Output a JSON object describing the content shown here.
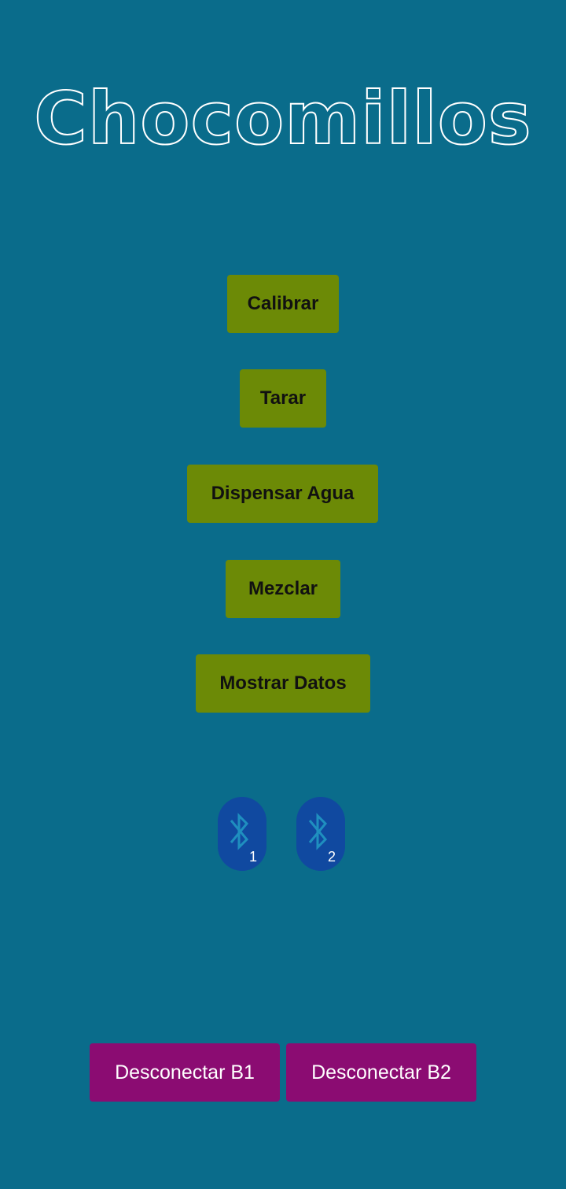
{
  "app": {
    "title": "Chocomillos"
  },
  "actions": {
    "calibrar": "Calibrar",
    "tarar": "Tarar",
    "dispensar_agua": "Dispensar Agua",
    "mezclar": "Mezclar",
    "mostrar_datos": "Mostrar Datos"
  },
  "bluetooth": [
    {
      "icon": "bluetooth-icon",
      "number": "1"
    },
    {
      "icon": "bluetooth-icon",
      "number": "2"
    }
  ],
  "disconnect": {
    "b1": "Desconectar B1",
    "b2": "Desconectar B2"
  },
  "colors": {
    "background": "#0a6c8b",
    "action_button": "#6c8a06",
    "bluetooth_button": "#1049a0",
    "bluetooth_glyph": "#1f8fbf",
    "disconnect_button": "#8b0c72"
  }
}
